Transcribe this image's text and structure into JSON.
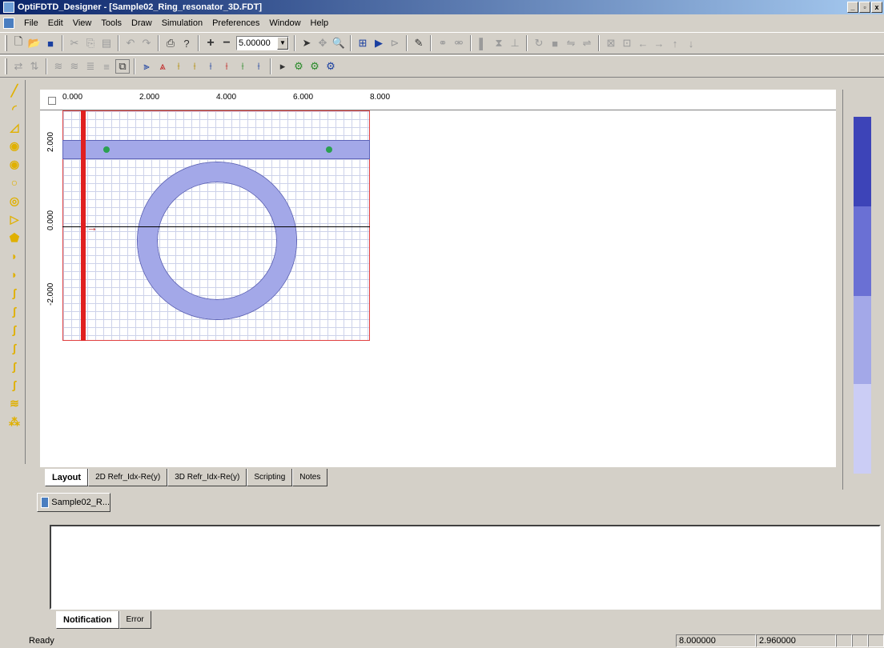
{
  "window": {
    "title": "OptiFDTD_Designer - [Sample02_Ring_resonator_3D.FDT]",
    "min_label": "_",
    "max_label": "▫",
    "close_label": "x"
  },
  "menu": {
    "items": [
      "File",
      "Edit",
      "View",
      "Tools",
      "Draw",
      "Simulation",
      "Preferences",
      "Window",
      "Help"
    ]
  },
  "toolbar": {
    "zoom_value": "5.00000",
    "plus": "+",
    "minus": "−"
  },
  "ruler": {
    "top_labels": [
      "0.000",
      "2.000",
      "4.000",
      "6.000",
      "8.000"
    ],
    "left_labels": [
      "2.000",
      "0.000",
      "-2.000"
    ]
  },
  "doc_tabs": [
    "Layout",
    "2D Refr_Idx-Re(y)",
    "3D Refr_Idx-Re(y)",
    "Scripting",
    "Notes"
  ],
  "mdi_tab": "Sample02_R...",
  "notif_tabs": [
    "Notification",
    "Error"
  ],
  "status": {
    "text": "Ready",
    "x": "8.000000",
    "y": "2.960000"
  },
  "colors": {
    "waveguide": "#a3a8e8",
    "source": "#e02020",
    "scale": [
      "#3d44b8",
      "#6a70d4",
      "#a3a8e8",
      "#cbcdf5"
    ]
  }
}
